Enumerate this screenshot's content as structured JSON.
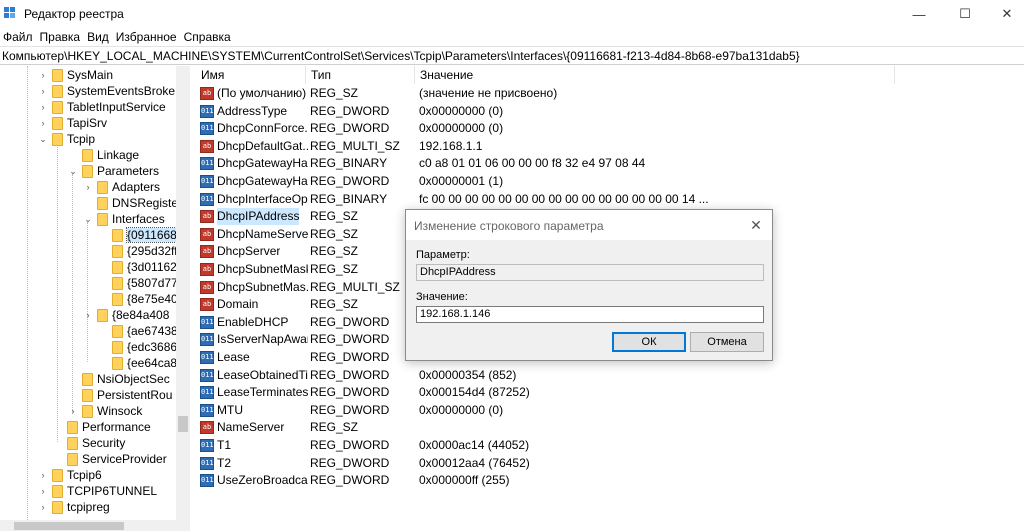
{
  "window": {
    "title": "Редактор реестра",
    "minimize_glyph": "—",
    "maximize_glyph": "☐",
    "close_glyph": "✕"
  },
  "menu": [
    "Файл",
    "Правка",
    "Вид",
    "Избранное",
    "Справка"
  ],
  "address": "Компьютер\\HKEY_LOCAL_MACHINE\\SYSTEM\\CurrentControlSet\\Services\\Tcpip\\Parameters\\Interfaces\\{09116681-f213-4d84-8b68-e97ba131dab5}",
  "tree": [
    {
      "label": "SysMain",
      "chev": "›"
    },
    {
      "label": "SystemEventsBroke",
      "chev": "›"
    },
    {
      "label": "TabletInputService",
      "chev": "›"
    },
    {
      "label": "TapiSrv",
      "chev": "›"
    },
    {
      "label": "Tcpip",
      "chev": "⌄"
    },
    {
      "label": "Linkage",
      "chev": ""
    },
    {
      "label": "Parameters",
      "chev": "⌄"
    },
    {
      "label": "Adapters",
      "chev": "›"
    },
    {
      "label": "DNSRegistere",
      "chev": ""
    },
    {
      "label": "Interfaces",
      "chev": "⌄"
    },
    {
      "label": "{09116681",
      "chev": "",
      "selected": true
    },
    {
      "label": "{295d32ff-",
      "chev": ""
    },
    {
      "label": "{3d011625",
      "chev": ""
    },
    {
      "label": "{5807d778",
      "chev": ""
    },
    {
      "label": "{8e75e403",
      "chev": ""
    },
    {
      "label": "{8e84a408",
      "chev": "›"
    },
    {
      "label": "{ae674382",
      "chev": ""
    },
    {
      "label": "{edc3686b",
      "chev": ""
    },
    {
      "label": "{ee64ca84",
      "chev": ""
    },
    {
      "label": "NsiObjectSec",
      "chev": ""
    },
    {
      "label": "PersistentRou",
      "chev": ""
    },
    {
      "label": "Winsock",
      "chev": "›"
    },
    {
      "label": "Performance",
      "chev": ""
    },
    {
      "label": "Security",
      "chev": ""
    },
    {
      "label": "ServiceProvider",
      "chev": ""
    },
    {
      "label": "Tcpip6",
      "chev": "›"
    },
    {
      "label": "TCPIP6TUNNEL",
      "chev": "›"
    },
    {
      "label": "tcpipreg",
      "chev": "›"
    }
  ],
  "columns": {
    "name": "Имя",
    "type": "Тип",
    "data": "Значение"
  },
  "rows": [
    {
      "name": "(По умолчанию)",
      "type": "REG_SZ",
      "data": "(значение не присвоено)",
      "icon": "ab"
    },
    {
      "name": "AddressType",
      "type": "REG_DWORD",
      "data": "0x00000000 (0)",
      "icon": "bin"
    },
    {
      "name": "DhcpConnForce...",
      "type": "REG_DWORD",
      "data": "0x00000000 (0)",
      "icon": "bin"
    },
    {
      "name": "DhcpDefaultGat...",
      "type": "REG_MULTI_SZ",
      "data": "192.168.1.1",
      "icon": "ab"
    },
    {
      "name": "DhcpGatewayHa...",
      "type": "REG_BINARY",
      "data": "c0 a8 01 01 06 00 00 00 f8 32 e4 97 08 44",
      "icon": "bin"
    },
    {
      "name": "DhcpGatewayHa...",
      "type": "REG_DWORD",
      "data": "0x00000001 (1)",
      "icon": "bin"
    },
    {
      "name": "DhcpInterfaceOp...",
      "type": "REG_BINARY",
      "data": "fc 00 00 00 00 00 00 00 00 00 00 00 00 00 00 00 14 ...",
      "icon": "bin"
    },
    {
      "name": "DhcpIPAddress",
      "type": "REG_SZ",
      "data": "",
      "icon": "ab",
      "selected": true
    },
    {
      "name": "DhcpNameServer",
      "type": "REG_SZ",
      "data": "",
      "icon": "ab"
    },
    {
      "name": "DhcpServer",
      "type": "REG_SZ",
      "data": "",
      "icon": "ab"
    },
    {
      "name": "DhcpSubnetMask",
      "type": "REG_SZ",
      "data": "",
      "icon": "ab"
    },
    {
      "name": "DhcpSubnetMas...",
      "type": "REG_MULTI_SZ",
      "data": "",
      "icon": "ab"
    },
    {
      "name": "Domain",
      "type": "REG_SZ",
      "data": "",
      "icon": "ab"
    },
    {
      "name": "EnableDHCP",
      "type": "REG_DWORD",
      "data": "",
      "icon": "bin"
    },
    {
      "name": "IsServerNapAware",
      "type": "REG_DWORD",
      "data": "",
      "icon": "bin"
    },
    {
      "name": "Lease",
      "type": "REG_DWORD",
      "data": "",
      "icon": "bin"
    },
    {
      "name": "LeaseObtainedTi...",
      "type": "REG_DWORD",
      "data": "0x00000354 (852)",
      "icon": "bin"
    },
    {
      "name": "LeaseTerminates...",
      "type": "REG_DWORD",
      "data": "0x000154d4 (87252)",
      "icon": "bin"
    },
    {
      "name": "MTU",
      "type": "REG_DWORD",
      "data": "0x00000000 (0)",
      "icon": "bin"
    },
    {
      "name": "NameServer",
      "type": "REG_SZ",
      "data": "",
      "icon": "ab"
    },
    {
      "name": "T1",
      "type": "REG_DWORD",
      "data": "0x0000ac14 (44052)",
      "icon": "bin"
    },
    {
      "name": "T2",
      "type": "REG_DWORD",
      "data": "0x00012aa4 (76452)",
      "icon": "bin"
    },
    {
      "name": "UseZeroBroadcast",
      "type": "REG_DWORD",
      "data": "0x000000ff (255)",
      "icon": "bin"
    }
  ],
  "dialog": {
    "title": "Изменение строкового параметра",
    "close_glyph": "✕",
    "param_label": "Параметр:",
    "param_value": "DhcpIPAddress",
    "value_label": "Значение:",
    "value": "192.168.1.146",
    "ok_label": "ОК",
    "cancel_label": "Отмена"
  },
  "icons": {
    "string_value": "ab",
    "binary_value": "011"
  },
  "colors": {
    "selection": "#cce8ff",
    "folder": "#ffd35b",
    "string_icon": "#c0392b",
    "binary_icon": "#2e6db4",
    "accent": "#0078d7"
  }
}
